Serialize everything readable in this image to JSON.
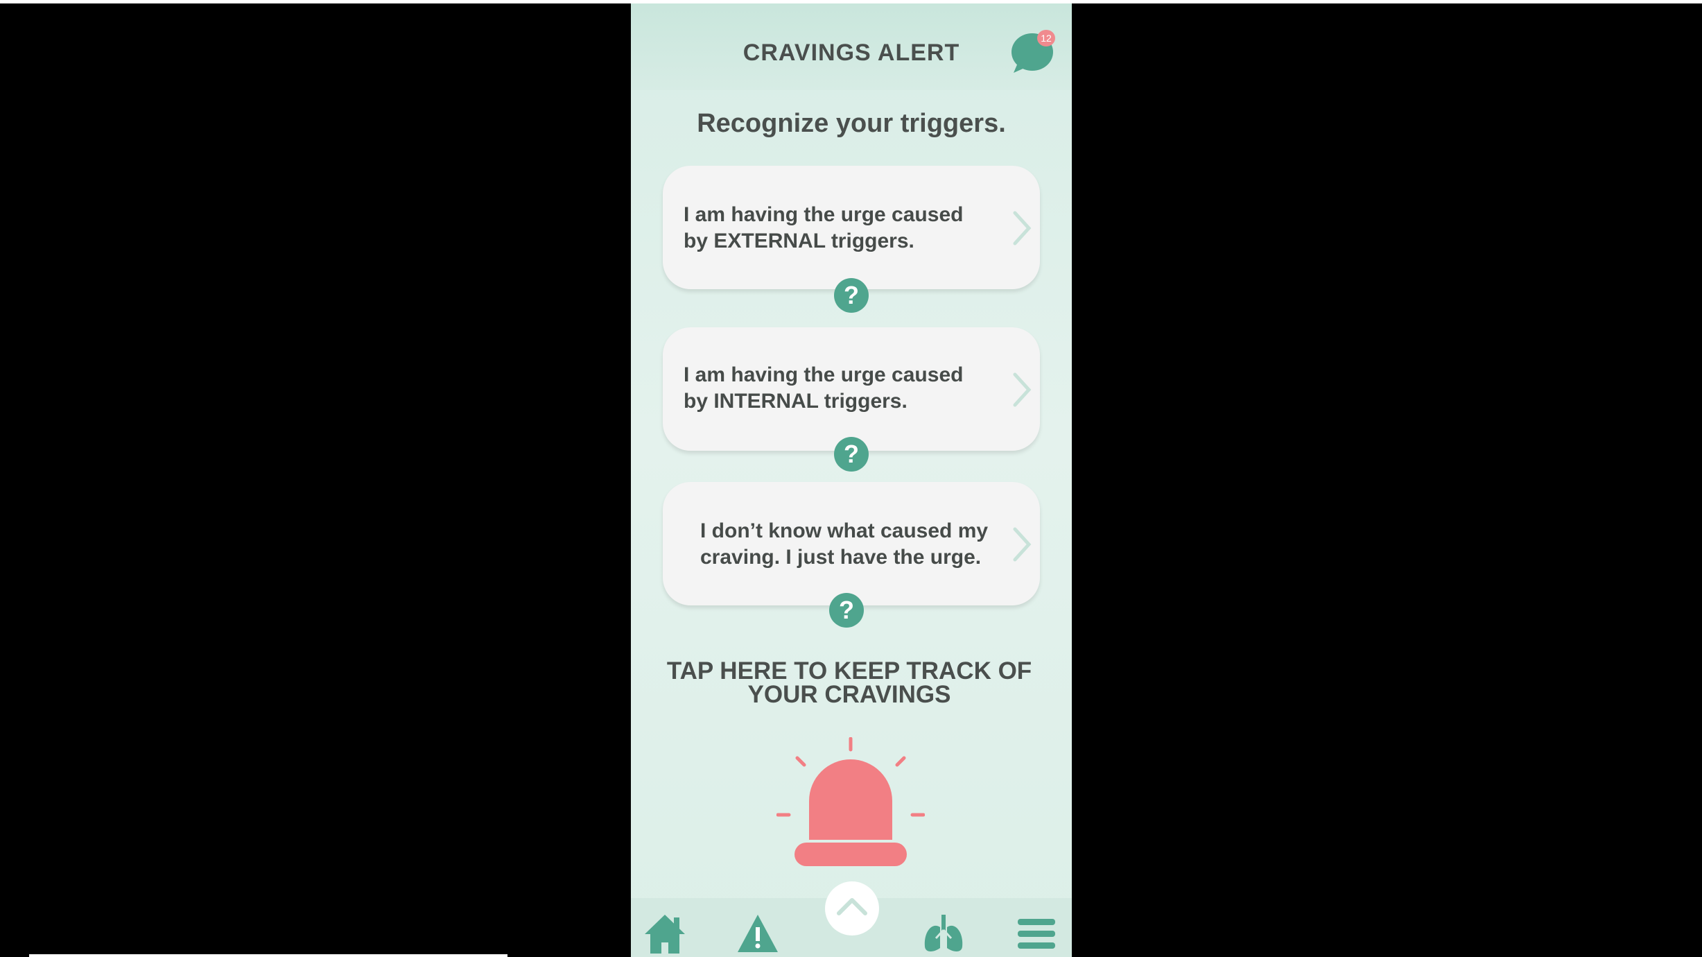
{
  "header": {
    "title": "CRAVINGS ALERT",
    "chat_badge_count": "12"
  },
  "subtitle": "Recognize your triggers.",
  "cards": [
    {
      "line1": "I am having the urge caused",
      "line2": "by EXTERNAL triggers."
    },
    {
      "line1": "I am having the urge caused",
      "line2": "by INTERNAL triggers."
    },
    {
      "line1": "I don’t know what caused my",
      "line2": "craving. I just have the urge."
    }
  ],
  "help_symbol": "?",
  "track": {
    "line1": "TAP HERE TO KEEP TRACK OF",
    "line2": "YOUR CRAVINGS"
  },
  "colors": {
    "accent": "#4fa58e",
    "alert": "#f27f84",
    "text": "#4a4f4d",
    "card": "#f4f4f4"
  },
  "icons": [
    "chat-icon",
    "chevron-right-icon",
    "help-icon",
    "siren-icon",
    "home-icon",
    "warning-icon",
    "chevron-up-icon",
    "lungs-icon",
    "menu-icon"
  ]
}
